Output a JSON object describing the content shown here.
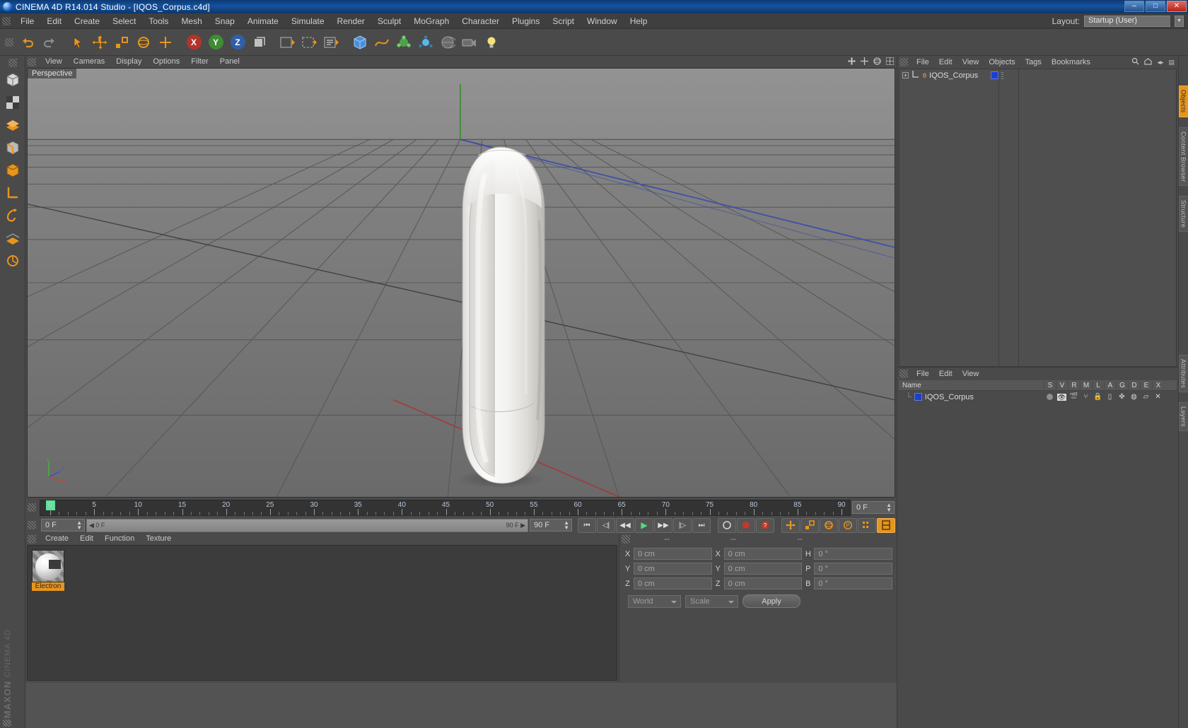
{
  "window": {
    "title": "CINEMA 4D R14.014 Studio - [IQOS_Corpus.c4d]",
    "app_icon": "c4d-logo-icon",
    "minimize": "–",
    "maximize": "□",
    "close": "✕"
  },
  "menu": {
    "items": [
      "File",
      "Edit",
      "Create",
      "Select",
      "Tools",
      "Mesh",
      "Snap",
      "Animate",
      "Simulate",
      "Render",
      "Sculpt",
      "MoGraph",
      "Character",
      "Plugins",
      "Script",
      "Window",
      "Help"
    ],
    "layout_label": "Layout:",
    "layout_value": "Startup (User)"
  },
  "toolbar": {
    "buttons": [
      {
        "name": "undo-button",
        "glyph": "↶"
      },
      {
        "name": "redo-button",
        "glyph": "↷"
      },
      {
        "name": "live-selection-button",
        "glyph": "➚"
      },
      {
        "name": "move-button",
        "glyph": "✥"
      },
      {
        "name": "scale-button",
        "glyph": "▣"
      },
      {
        "name": "rotate-button",
        "glyph": "↻"
      },
      {
        "name": "magnet-button",
        "glyph": "✛"
      },
      {
        "name": "lock-x-axis-button",
        "glyph": "X"
      },
      {
        "name": "lock-y-axis-button",
        "glyph": "Y"
      },
      {
        "name": "lock-z-axis-button",
        "glyph": "Z"
      },
      {
        "name": "world-object-coordinates-button",
        "glyph": "◲"
      },
      {
        "name": "render-view-button",
        "glyph": "▸"
      },
      {
        "name": "render-region-button",
        "glyph": "▸▸"
      },
      {
        "name": "render-settings-button",
        "glyph": "▸≡"
      },
      {
        "name": "cube-primitive-button",
        "glyph": "◼"
      },
      {
        "name": "spline-button",
        "glyph": "∿"
      },
      {
        "name": "generator-button",
        "glyph": "✿"
      },
      {
        "name": "deformer-button",
        "glyph": "❊"
      },
      {
        "name": "scene-object-button",
        "glyph": "◕"
      },
      {
        "name": "camera-button",
        "glyph": "🎥"
      },
      {
        "name": "light-button",
        "glyph": "💡"
      }
    ]
  },
  "left_rail": {
    "buttons": [
      {
        "name": "model-mode-button",
        "glyph": "◰"
      },
      {
        "name": "texture-mode-button",
        "glyph": "▩"
      },
      {
        "name": "points-mode-button",
        "glyph": "⬚"
      },
      {
        "name": "edges-mode-button",
        "glyph": "◩"
      },
      {
        "name": "polygons-mode-button",
        "glyph": "◆"
      },
      {
        "name": "axis-mode-button",
        "glyph": "⌐"
      },
      {
        "name": "enable-axis-button",
        "glyph": "↯"
      },
      {
        "name": "viewport-solo-button",
        "glyph": "▦"
      },
      {
        "name": "lock-workplane-button",
        "glyph": "⟳"
      }
    ],
    "brand_top": "MAXON",
    "brand_bottom": "CINEMA 4D"
  },
  "viewport": {
    "menu": [
      "View",
      "Cameras",
      "Display",
      "Options",
      "Filter",
      "Panel"
    ],
    "label": "Perspective",
    "corner_icons": [
      "pan-icon",
      "zoom-icon",
      "rotate-icon",
      "camera-icon"
    ],
    "axis": {
      "x": "X",
      "y": "Y",
      "z": "Z"
    },
    "object_name": "IQOS_Corpus"
  },
  "timeline": {
    "ticks": [
      0,
      5,
      10,
      15,
      20,
      25,
      30,
      35,
      40,
      45,
      50,
      55,
      60,
      65,
      70,
      75,
      80,
      85,
      90
    ],
    "current_frame_box": "0 F",
    "range_start": "0 F",
    "range_end": "90 F",
    "end_frame_box": "90 F",
    "playhead_frame": 0,
    "controls": [
      {
        "name": "goto-start-button",
        "glyph": "⏮"
      },
      {
        "name": "step-back-keyframe-button",
        "glyph": "◁|"
      },
      {
        "name": "step-back-frame-button",
        "glyph": "◀◀"
      },
      {
        "name": "play-button",
        "glyph": "▶"
      },
      {
        "name": "step-forward-frame-button",
        "glyph": "▶▶"
      },
      {
        "name": "step-forward-keyframe-button",
        "glyph": "|▷"
      },
      {
        "name": "goto-end-button",
        "glyph": "⏭"
      }
    ],
    "record_controls": [
      {
        "name": "autokeying-button",
        "glyph": "◎"
      },
      {
        "name": "record-active-objects-button",
        "glyph": "⏺"
      },
      {
        "name": "keyframe-selection-button",
        "glyph": "?"
      },
      {
        "name": "position-key-button",
        "glyph": "✥"
      },
      {
        "name": "scale-key-button",
        "glyph": "▣"
      },
      {
        "name": "rotation-key-button",
        "glyph": "↻"
      },
      {
        "name": "parameter-key-button",
        "glyph": "P"
      },
      {
        "name": "point-level-animation-button",
        "glyph": "⣿"
      },
      {
        "name": "keyframe-mode-button",
        "glyph": "▤"
      }
    ]
  },
  "material_manager": {
    "menu": [
      "Create",
      "Edit",
      "Function",
      "Texture"
    ],
    "materials": [
      {
        "name": "Electron"
      }
    ]
  },
  "coordinates": {
    "headers": [
      "--",
      "--",
      "--"
    ],
    "rows": [
      {
        "pos_label": "X",
        "pos_value": "0 cm",
        "size_label": "X",
        "size_value": "0 cm",
        "rot_label": "H",
        "rot_value": "0 °"
      },
      {
        "pos_label": "Y",
        "pos_value": "0 cm",
        "size_label": "Y",
        "size_value": "0 cm",
        "rot_label": "P",
        "rot_value": "0 °"
      },
      {
        "pos_label": "Z",
        "pos_value": "0 cm",
        "size_label": "Z",
        "size_value": "0 cm",
        "rot_label": "B",
        "rot_value": "0 °"
      }
    ],
    "coord_system": "World",
    "mode": "Scale",
    "apply_label": "Apply"
  },
  "object_manager": {
    "menu": [
      "File",
      "Edit",
      "View",
      "Objects",
      "Tags",
      "Bookmarks"
    ],
    "search_icon": "search-icon",
    "home_icon": "home-icon",
    "object": {
      "name": "IQOS_Corpus",
      "layer_color": "#1c3fd0",
      "level_badge": "0"
    }
  },
  "layer_manager": {
    "menu": [
      "File",
      "Edit",
      "View"
    ],
    "columns": [
      "Name",
      "S",
      "V",
      "R",
      "M",
      "L",
      "A",
      "G",
      "D",
      "E",
      "X"
    ],
    "rows": [
      {
        "name": "IQOS_Corpus",
        "color": "#1c3fd0"
      }
    ]
  },
  "right_tabs": [
    {
      "label": "Objects",
      "active": true
    },
    {
      "label": "Content Browser",
      "active": false
    },
    {
      "label": "Structure",
      "active": false
    },
    {
      "label": "Attributes",
      "active": false
    },
    {
      "label": "Layers",
      "active": false
    }
  ],
  "colors": {
    "accent_orange": "#e7951d",
    "panel_bg": "#4a4a4a",
    "dark_bg": "#3c3c3c",
    "title_blue": "#1552a0",
    "layer_blue": "#1c3fd0",
    "playhead_green": "#5fe49b"
  }
}
